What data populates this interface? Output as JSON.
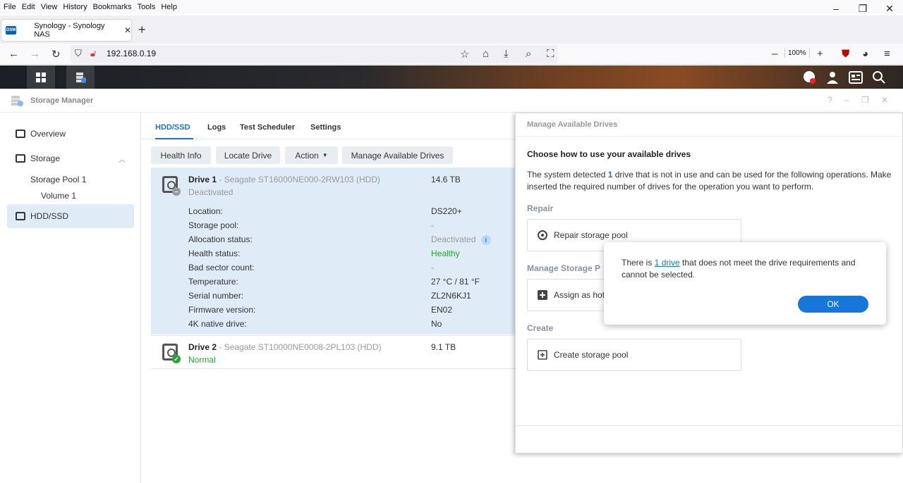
{
  "browser": {
    "menu": [
      "File",
      "Edit",
      "View",
      "History",
      "Bookmarks",
      "Tools",
      "Help"
    ],
    "tab_title": "Synology - Synology NAS",
    "favicon_text": "DSM",
    "url": "192.168.0.19",
    "zoom": "100%"
  },
  "window": {
    "title": "Storage Manager"
  },
  "sidebar": {
    "overview": "Overview",
    "storage": "Storage",
    "storage_pool": "Storage Pool 1",
    "volume": "Volume 1",
    "hdd": "HDD/SSD"
  },
  "tabs": [
    "HDD/SSD",
    "Logs",
    "Test Scheduler",
    "Settings"
  ],
  "toolbar": {
    "health_info": "Health Info",
    "locate_drive": "Locate Drive",
    "action": "Action",
    "manage_drives": "Manage Available Drives"
  },
  "drives": [
    {
      "name": "Drive 1",
      "model": "- Seagate ST16000NE000-2RW103 (HDD)",
      "status": "Deactivated",
      "capacity": "14.6 TB",
      "details": [
        {
          "label": "Location:",
          "value": "DS220+"
        },
        {
          "label": "Storage pool:",
          "value": "-"
        },
        {
          "label": "Allocation status:",
          "value": "Deactivated"
        },
        {
          "label": "Health status:",
          "value": "Healthy"
        },
        {
          "label": "Bad sector count:",
          "value": "-"
        },
        {
          "label": "Temperature:",
          "value": "27 °C / 81 °F"
        },
        {
          "label": "Serial number:",
          "value": "ZL2N6KJ1"
        },
        {
          "label": "Firmware version:",
          "value": "EN02"
        },
        {
          "label": "4K native drive:",
          "value": "No"
        }
      ]
    },
    {
      "name": "Drive 2",
      "model": "- Seagate ST10000NE0008-2PL103 (HDD)",
      "status": "Normal",
      "capacity": "9.1 TB"
    }
  ],
  "panel": {
    "title": "Manage Available Drives",
    "heading": "Choose how to use your available drives",
    "desc_pre": "The system detected ",
    "desc_num": "1",
    "desc_post": " drive that is not in use and can be used for the following operations. Make",
    "desc_line2": "inserted the required number of drives for the operation you want to perform.",
    "repair_section": "Repair",
    "repair_option": "Repair storage pool",
    "manage_section": "Manage Storage P",
    "hotspare_option": "Assign as hot",
    "create_section": "Create",
    "create_option": "Create storage pool"
  },
  "alert": {
    "pre": "There is ",
    "link": "1 drive",
    "post": " that does not meet the drive requirements and cannot be selected.",
    "ok": "OK"
  },
  "colors": {
    "accent": "#1d74c7",
    "healthy": "#2aa036",
    "selected_row": "#dfecf8",
    "ok_button": "#1677d9"
  }
}
